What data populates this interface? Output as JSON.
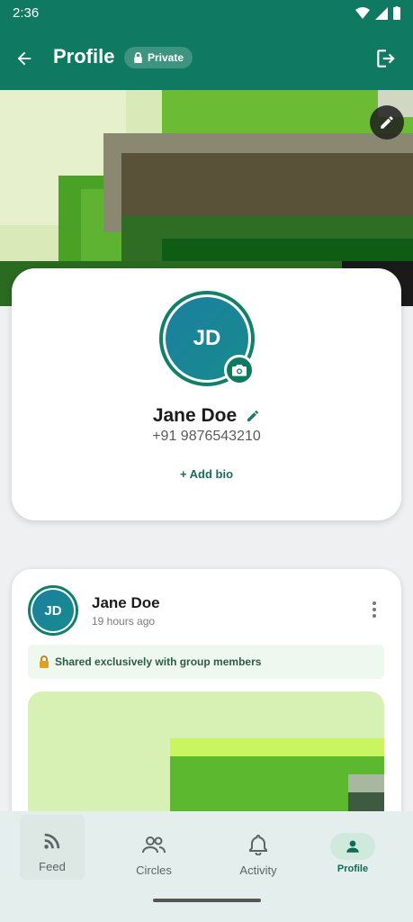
{
  "status_bar": {
    "time": "2:36"
  },
  "app_bar": {
    "title": "Profile",
    "badge": "Private"
  },
  "profile": {
    "initials": "JD",
    "name": "Jane Doe",
    "phone": "+91 9876543210",
    "add_bio": "+ Add bio"
  },
  "post": {
    "author_initials": "JD",
    "author": "Jane Doe",
    "time": "19 hours ago",
    "visibility": "Shared exclusively with group members"
  },
  "nav": {
    "items": [
      {
        "label": "Feed",
        "icon": "rss-feed-icon"
      },
      {
        "label": "Circles",
        "icon": "group-icon"
      },
      {
        "label": "Activity",
        "icon": "bell-icon"
      },
      {
        "label": "Profile",
        "icon": "person-icon",
        "active": true
      }
    ]
  },
  "colors": {
    "primary": "#0f7a61",
    "accent": "#11806a"
  }
}
